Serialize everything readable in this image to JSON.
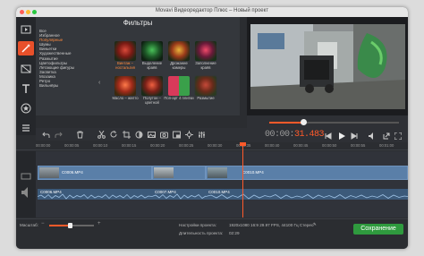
{
  "window": {
    "title": "Movavi Видеоредактор Плюс – Новый проект",
    "colors": {
      "accent": "#ff5a2a",
      "save": "#2f9a3e",
      "clip": "#5a7fa8"
    }
  },
  "sidebar": {
    "tools": [
      {
        "icon": "film-import-icon"
      },
      {
        "icon": "magic-wand-icon"
      },
      {
        "icon": "transitions-icon"
      },
      {
        "icon": "text-icon"
      },
      {
        "icon": "star-icon"
      },
      {
        "icon": "list-icon"
      }
    ]
  },
  "filters": {
    "title": "Фильтры",
    "categories": [
      "Все",
      "Избранное",
      "Популярные",
      "Шумы",
      "Виньетки",
      "Художественные",
      "Размытие",
      "Цветофильтры",
      "Летающие фигуры",
      "Засветка",
      "Мозаика",
      "Ретро",
      "Вильнёры"
    ],
    "selected_category": 2,
    "items": [
      {
        "label": "Винтаж – ностальгия",
        "selected": true
      },
      {
        "label": "Выделение краёв"
      },
      {
        "label": "Дрожание камеры"
      },
      {
        "label": "Заполнение краёв"
      },
      {
        "label": "Масло – желто"
      },
      {
        "label": "Полутон – цветной"
      },
      {
        "label": "Поп-арт 4 плитки"
      },
      {
        "label": "Размытие"
      }
    ]
  },
  "player": {
    "timecode_prefix": "00:00:",
    "timecode_highlight": "31.483",
    "progress": 0.26
  },
  "timeline": {
    "ruler_ticks": [
      "00:00:00",
      "00:00:05",
      "00:00:10",
      "00:00:15",
      "00:00:20",
      "00:00:25",
      "00:00:30",
      "00:00:35",
      "00:00:40",
      "00:00:45",
      "00:00:50",
      "00:00:55",
      "00:01:00"
    ],
    "video_clips": [
      "C0006.MP4",
      "C0007.MP4",
      "C0010.MP4"
    ],
    "audio_clips": [
      "C0006.MP4",
      "C0007.MP4",
      "C0010.MP4"
    ]
  },
  "status": {
    "scale_label": "Масштаб:",
    "zoom": 0.45,
    "settings_label": "Настройки проекта:",
    "settings_value": "1920x1080 16:9 29.97 FPS, 44100 Гц Стерео",
    "duration_label": "Длительность проекта:",
    "duration_value": "02:29",
    "save_label": "Сохранение"
  }
}
